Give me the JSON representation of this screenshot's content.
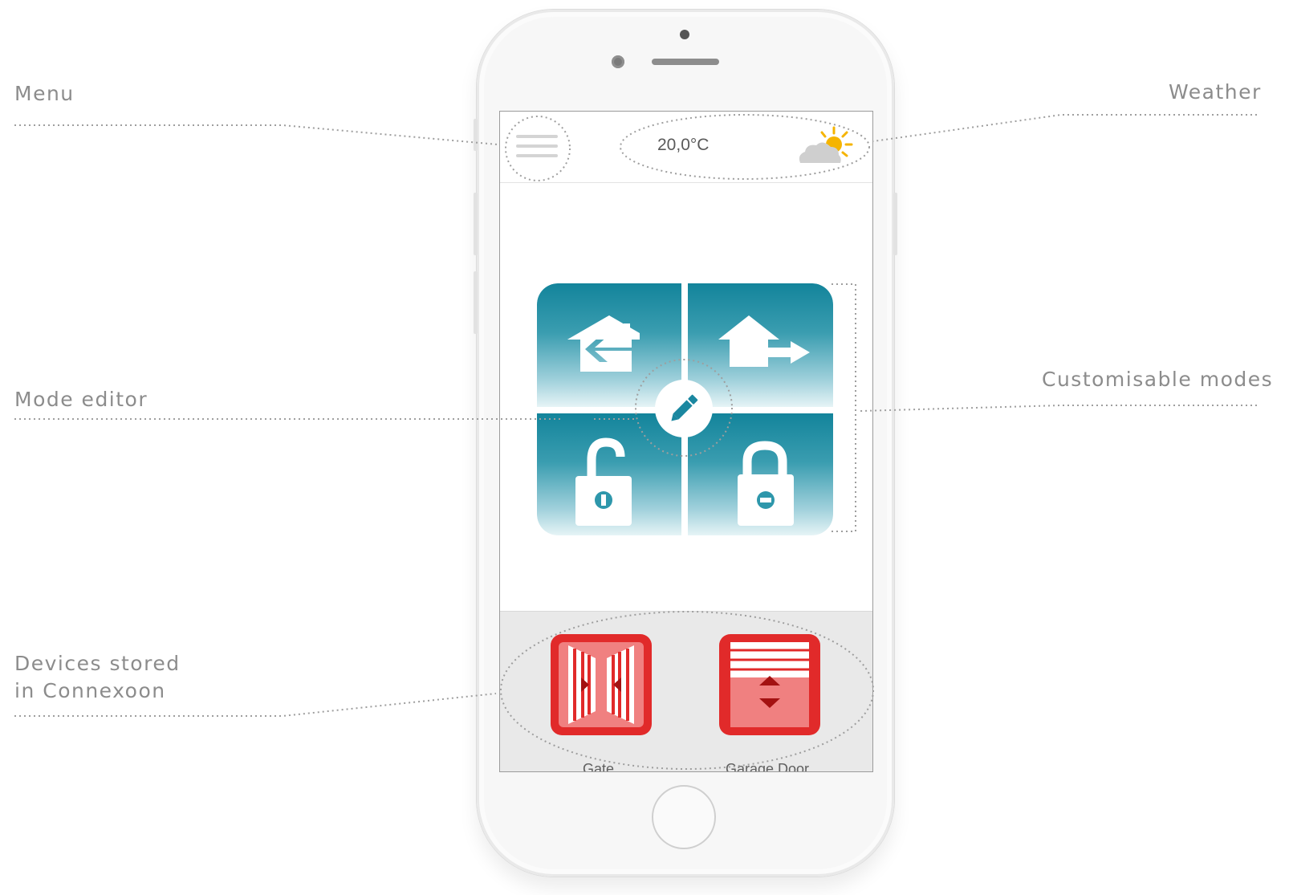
{
  "annotations": {
    "menu": "Menu",
    "weather": "Weather",
    "mode_editor": "Mode editor",
    "customisable_modes": "Customisable modes",
    "devices_line1": "Devices stored",
    "devices_line2": "in Connexoon"
  },
  "header": {
    "temperature": "20,0°C",
    "weather_icon": "sun-cloud-icon",
    "menu_icon": "hamburger-icon"
  },
  "modes": [
    {
      "name": "arrive-home",
      "icon": "home-arrive-icon"
    },
    {
      "name": "leave-home",
      "icon": "home-leave-icon"
    },
    {
      "name": "unlock",
      "icon": "unlocked-padlock-icon"
    },
    {
      "name": "lock",
      "icon": "locked-padlock-icon"
    }
  ],
  "mode_editor_icon": "pencil-icon",
  "devices": [
    {
      "label": "Gate",
      "icon": "gate-icon"
    },
    {
      "label": "Garage Door",
      "icon": "garage-door-icon"
    }
  ],
  "colors": {
    "mode_teal": "#13849b",
    "device_red": "#e12a2a",
    "annotation_gray": "#8c8c8c"
  }
}
